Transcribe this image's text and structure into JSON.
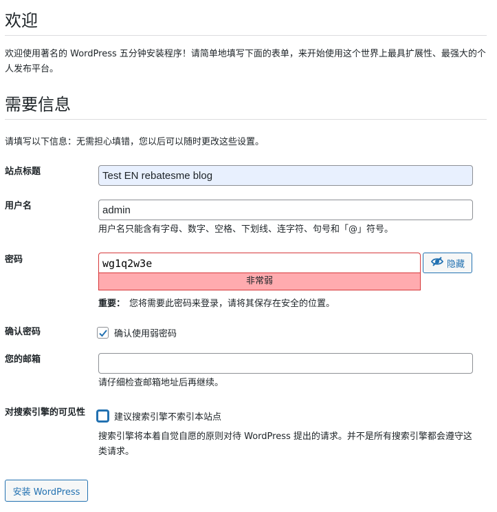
{
  "welcome": {
    "title": "欢迎",
    "intro": "欢迎使用著名的 WordPress 五分钟安装程序！请简单地填写下面的表单，来开始使用这个世界上最具扩展性、最强大的个人发布平台。"
  },
  "required": {
    "title": "需要信息",
    "info": "请填写以下信息：无需担心填错，您以后可以随时更改这些设置。"
  },
  "form": {
    "site_title": {
      "label": "站点标题",
      "value": "Test EN rebatesme blog"
    },
    "username": {
      "label": "用户名",
      "value": "admin",
      "hint": "用户名只能含有字母、数字、空格、下划线、连字符、句号和「@」符号。"
    },
    "password": {
      "label": "密码",
      "value": "wg1q2w3e",
      "strength": "非常弱",
      "hide_label": "隐藏",
      "important_label": "重要：",
      "important_text": "您将需要此密码来登录，请将其保存在安全的位置。"
    },
    "confirm": {
      "label": "确认密码",
      "checkbox_label": "确认使用弱密码",
      "checked": true
    },
    "email": {
      "label": "您的邮箱",
      "value": "",
      "hint": "请仔细检查邮箱地址后再继续。"
    },
    "visibility": {
      "label": "对搜索引擎的可见性",
      "checkbox_label": "建议搜索引擎不索引本站点",
      "checked": false,
      "hint": "搜索引擎将本着自觉自愿的原则对待 WordPress 提出的请求。并不是所有搜索引擎都会遵守这类请求。"
    }
  },
  "submit_label": "安装 WordPress",
  "colors": {
    "accent": "#2271b1",
    "error": "#d63638",
    "weak_bg": "#ffabaf",
    "autofill": "#e8f0fe"
  },
  "icons": {
    "hide": "eye-slash-icon",
    "check": "checkmark-icon"
  }
}
